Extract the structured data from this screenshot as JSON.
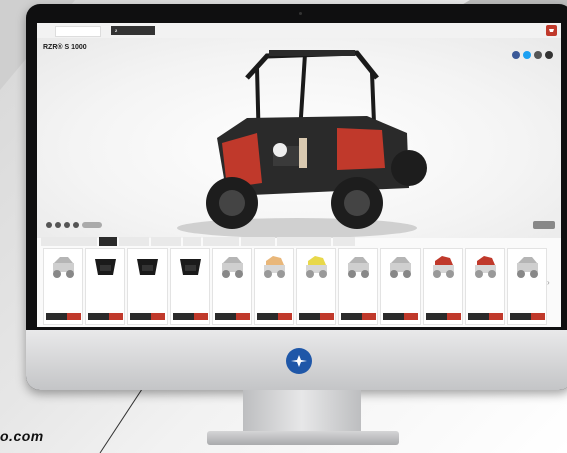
{
  "page": {
    "tagline": "o.com"
  },
  "screen": {
    "tabs": [
      {
        "label": "",
        "num": ""
      },
      {
        "label": "",
        "num": "2"
      }
    ],
    "product_title": "RZR® S 1000",
    "product_subtitle": "",
    "share_label": "",
    "share_icons": [
      {
        "name": "facebook-icon",
        "color": "#3b5998"
      },
      {
        "name": "twitter-icon",
        "color": "#1da1f2"
      },
      {
        "name": "email-icon",
        "color": "#555555"
      },
      {
        "name": "link-icon",
        "color": "#333333"
      }
    ],
    "categories": [
      "",
      "",
      "",
      "",
      "",
      "",
      "",
      "",
      "",
      "",
      ""
    ],
    "products": [
      {
        "thumb": "vehicle-roof"
      },
      {
        "thumb": "black-top"
      },
      {
        "thumb": "black-top"
      },
      {
        "thumb": "black-top"
      },
      {
        "thumb": "vehicle-roof"
      },
      {
        "thumb": "vehicle-orange"
      },
      {
        "thumb": "vehicle-yellow"
      },
      {
        "thumb": "vehicle-roof"
      },
      {
        "thumb": "vehicle-roof"
      },
      {
        "thumb": "vehicle-red"
      },
      {
        "thumb": "vehicle-red"
      },
      {
        "thumb": "vehicle-roof"
      }
    ]
  },
  "colors": {
    "accent": "#c0392b",
    "brand": "#1f57a8",
    "dark": "#2b2b2b"
  }
}
